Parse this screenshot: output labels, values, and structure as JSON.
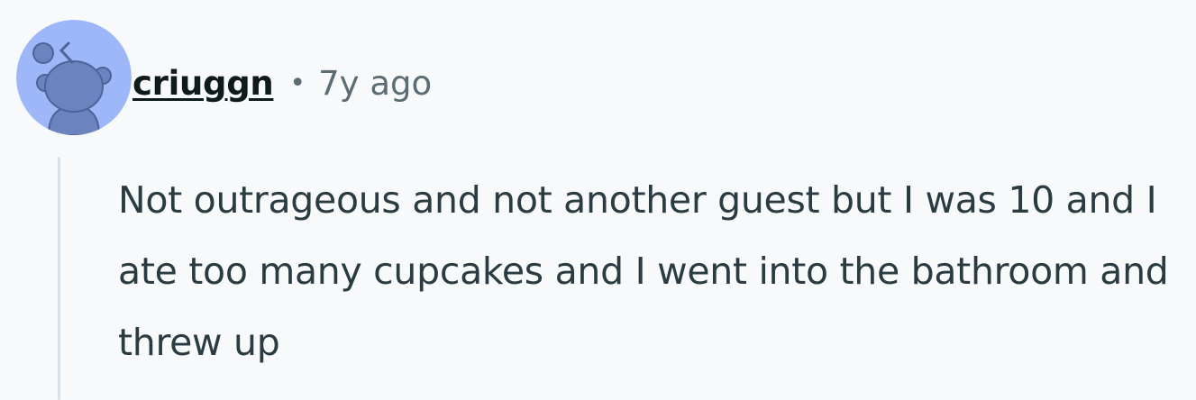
{
  "comment": {
    "username": "criuggn",
    "separator": "•",
    "timestamp": "7y ago",
    "body": "Not outrageous and not another guest but I was 10 and I ate too many cupcakes and I went into the bathroom and threw up",
    "avatar": {
      "icon": "snoo-avatar-icon",
      "background_color": "#9db7f8",
      "figure_color": "#6b84c0"
    }
  }
}
